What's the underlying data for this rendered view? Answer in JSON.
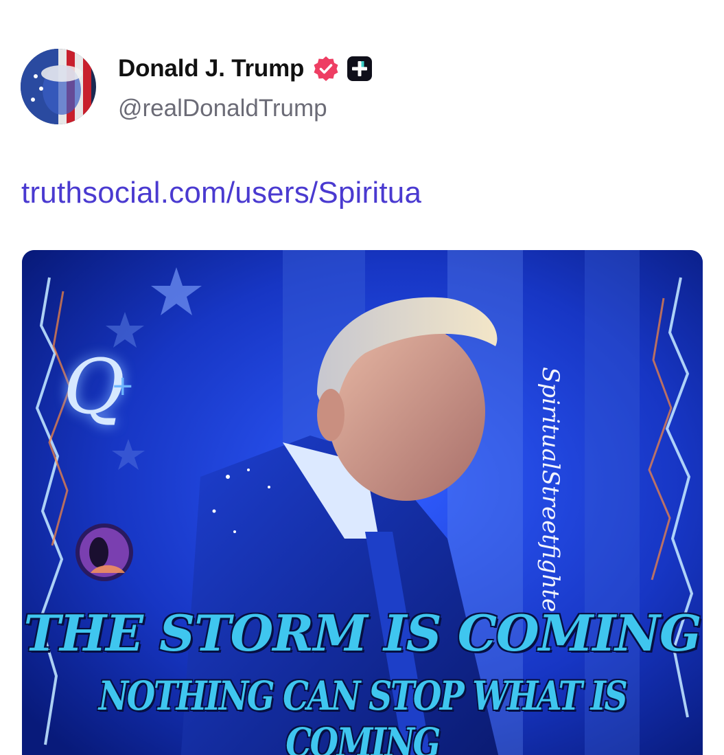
{
  "author": {
    "display_name": "Donald J. Trump",
    "handle": "@realDonaldTrump",
    "verified_badge_icon": "verified-check-icon",
    "plus_badge_icon": "plus-square-icon",
    "badge_color": "#ee3e63"
  },
  "post": {
    "link_text": "truthsocial.com/users/Spiritua",
    "link_color": "#4a3ad0"
  },
  "media": {
    "headline": "THE STORM IS COMING",
    "subline": "NOTHING CAN STOP WHAT IS COMING",
    "watermark": "SpiritualStreetfighter",
    "q_letter": "Q",
    "q_plus": "+"
  }
}
